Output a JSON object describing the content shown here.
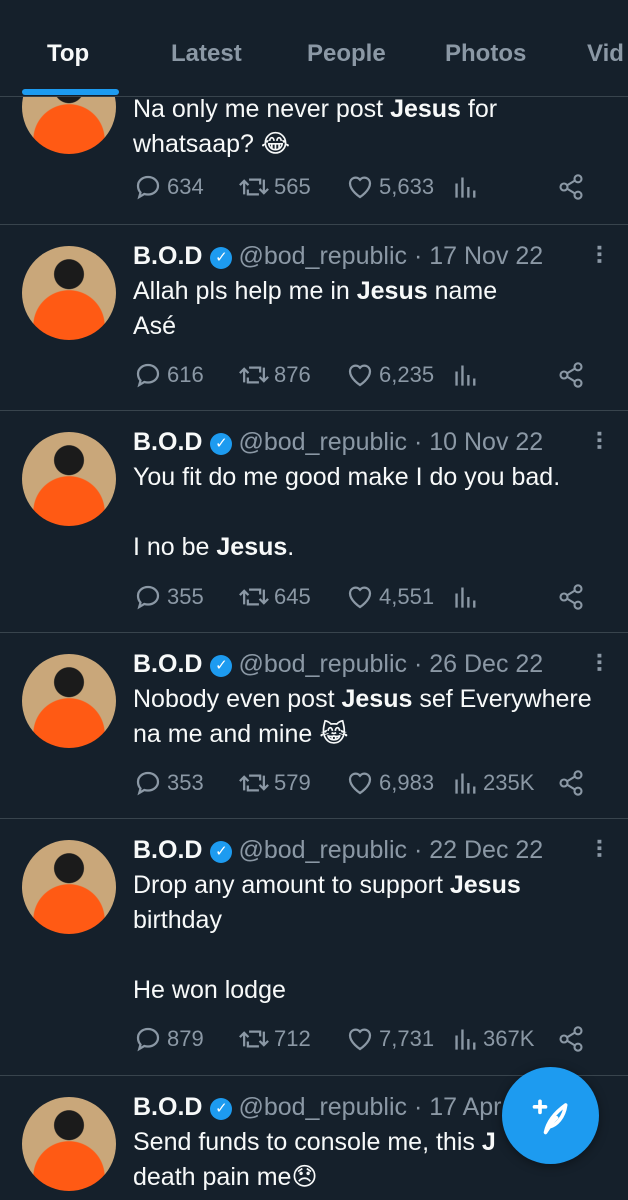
{
  "tabs": [
    {
      "label": "Top",
      "active": true
    },
    {
      "label": "Latest"
    },
    {
      "label": "People"
    },
    {
      "label": "Photos"
    },
    {
      "label": "Vid"
    }
  ],
  "colors": {
    "background": "#15202b",
    "accent": "#1d9bf0",
    "muted": "#8b98a5",
    "text": "#f7f9f9"
  },
  "tweets": [
    {
      "text_before": "Na only me never post ",
      "highlight": "Jesus",
      "text_after": " for\nwhatsaap? 😂",
      "replies": "634",
      "retweets": "565",
      "likes": "5,633",
      "views": ""
    },
    {
      "name": "B.O.D",
      "handle": "@bod_republic",
      "date": "17 Nov 22",
      "text_before": "Allah pls help me in ",
      "highlight": "Jesus",
      "text_after": " name\nAsé",
      "replies": "616",
      "retweets": "876",
      "likes": "6,235",
      "views": ""
    },
    {
      "name": "B.O.D",
      "handle": "@bod_republic",
      "date": "10 Nov 22",
      "text_before": "You fit do me good make I do you bad.\n\nI no be ",
      "highlight": "Jesus",
      "text_after": ".",
      "replies": "355",
      "retweets": "645",
      "likes": "4,551",
      "views": ""
    },
    {
      "name": "B.O.D",
      "handle": "@bod_republic",
      "date": "26 Dec 22",
      "text_before": "Nobody even post ",
      "highlight": "Jesus",
      "text_after": " sef Everywhere\nna me and mine 😹",
      "replies": "353",
      "retweets": "579",
      "likes": "6,983",
      "views": "235K"
    },
    {
      "name": "B.O.D",
      "handle": "@bod_republic",
      "date": "22 Dec 22",
      "text_before": "Drop any amount to support ",
      "highlight": "Jesus",
      "text_after": "\nbirthday\n\nHe won lodge",
      "replies": "879",
      "retweets": "712",
      "likes": "7,731",
      "views": "367K"
    },
    {
      "name": "B.O.D",
      "handle": "@bod_republic",
      "date": "17 Apr",
      "text_before": "Send funds to console me, this ",
      "highlight": "J",
      "text_after": "\ndeath pain me😞",
      "replies": "",
      "retweets": "",
      "likes": "",
      "views": ""
    }
  ],
  "fab": {
    "icon": "compose-feather-icon"
  },
  "sep": "·"
}
